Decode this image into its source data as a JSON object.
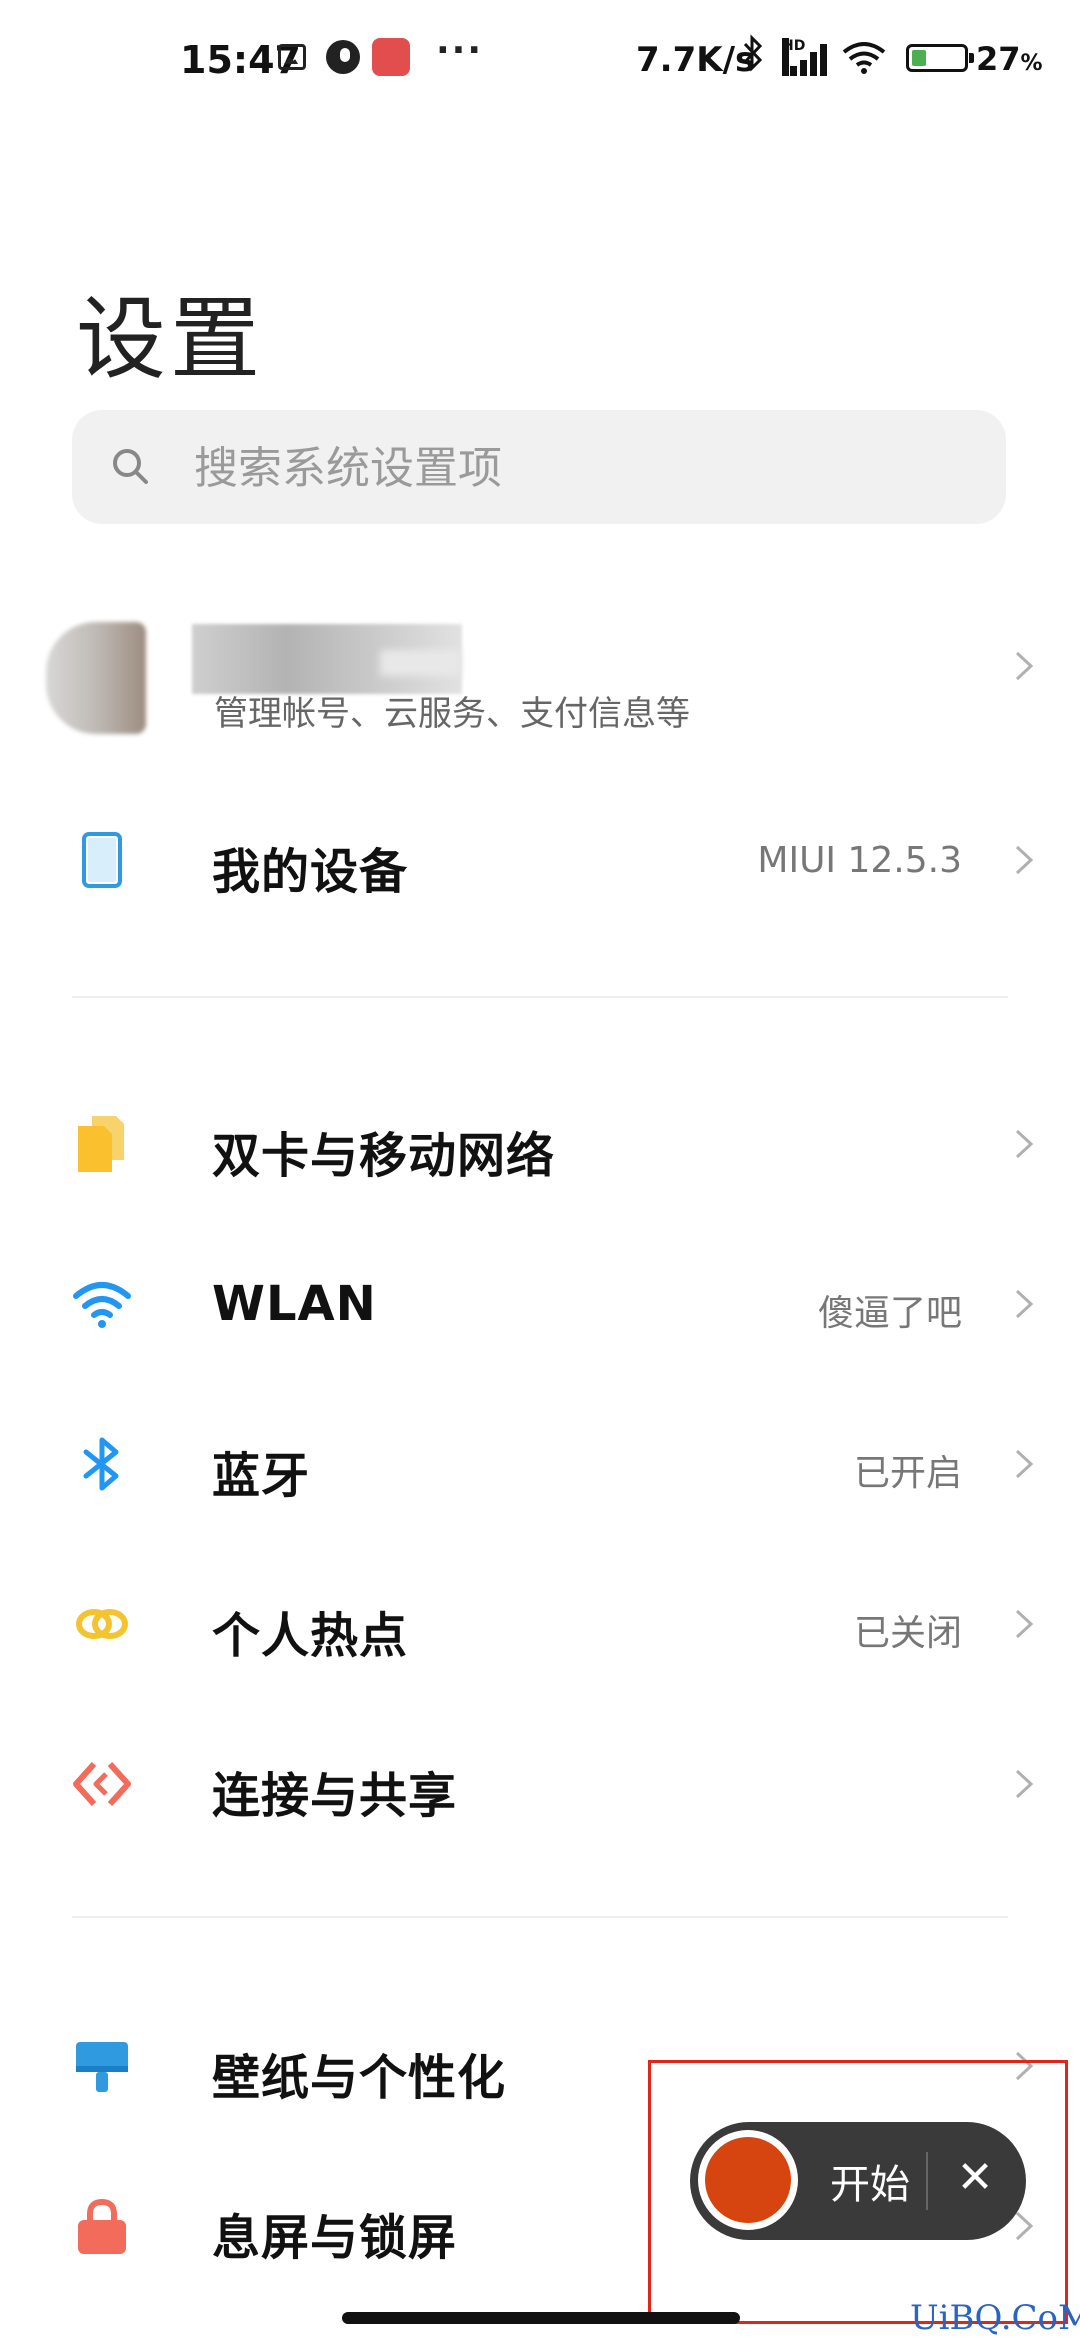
{
  "status_bar": {
    "time": "15:47",
    "dots": "···",
    "net_speed": "7.7K/s",
    "bluetooth_glyph": "✱",
    "hd_label": "HD",
    "battery_pct": "27",
    "battery_unit": "%"
  },
  "title": "设置",
  "search": {
    "placeholder": "搜索系统设置项"
  },
  "account": {
    "subtitle": "管理帐号、云服务、支付信息等"
  },
  "rows": [
    {
      "label": "我的设备",
      "value": "MIUI 12.5.3",
      "icon": "phone-icon",
      "color": "#2f9ae0"
    },
    {
      "label": "双卡与移动网络",
      "value": "",
      "icon": "sim-card-icon",
      "color": "#fbc02d"
    },
    {
      "label": "WLAN",
      "value": "傻逼了吧",
      "icon": "wifi-icon",
      "color": "#2196f3"
    },
    {
      "label": "蓝牙",
      "value": "已开启",
      "icon": "bluetooth-icon",
      "color": "#2196f3"
    },
    {
      "label": "个人热点",
      "value": "已关闭",
      "icon": "hotspot-icon",
      "color": "#f4c430"
    },
    {
      "label": "连接与共享",
      "value": "",
      "icon": "share-icon",
      "color": "#f26b5b"
    },
    {
      "label": "壁纸与个性化",
      "value": "",
      "icon": "paint-brush-icon",
      "color": "#2f9ae0"
    },
    {
      "label": "息屏与锁屏",
      "value": "",
      "icon": "lock-icon",
      "color": "#f26b5b"
    }
  ],
  "recorder": {
    "start_label": "开始",
    "close_glyph": "✕"
  },
  "watermark": "UiBQ.CoM"
}
